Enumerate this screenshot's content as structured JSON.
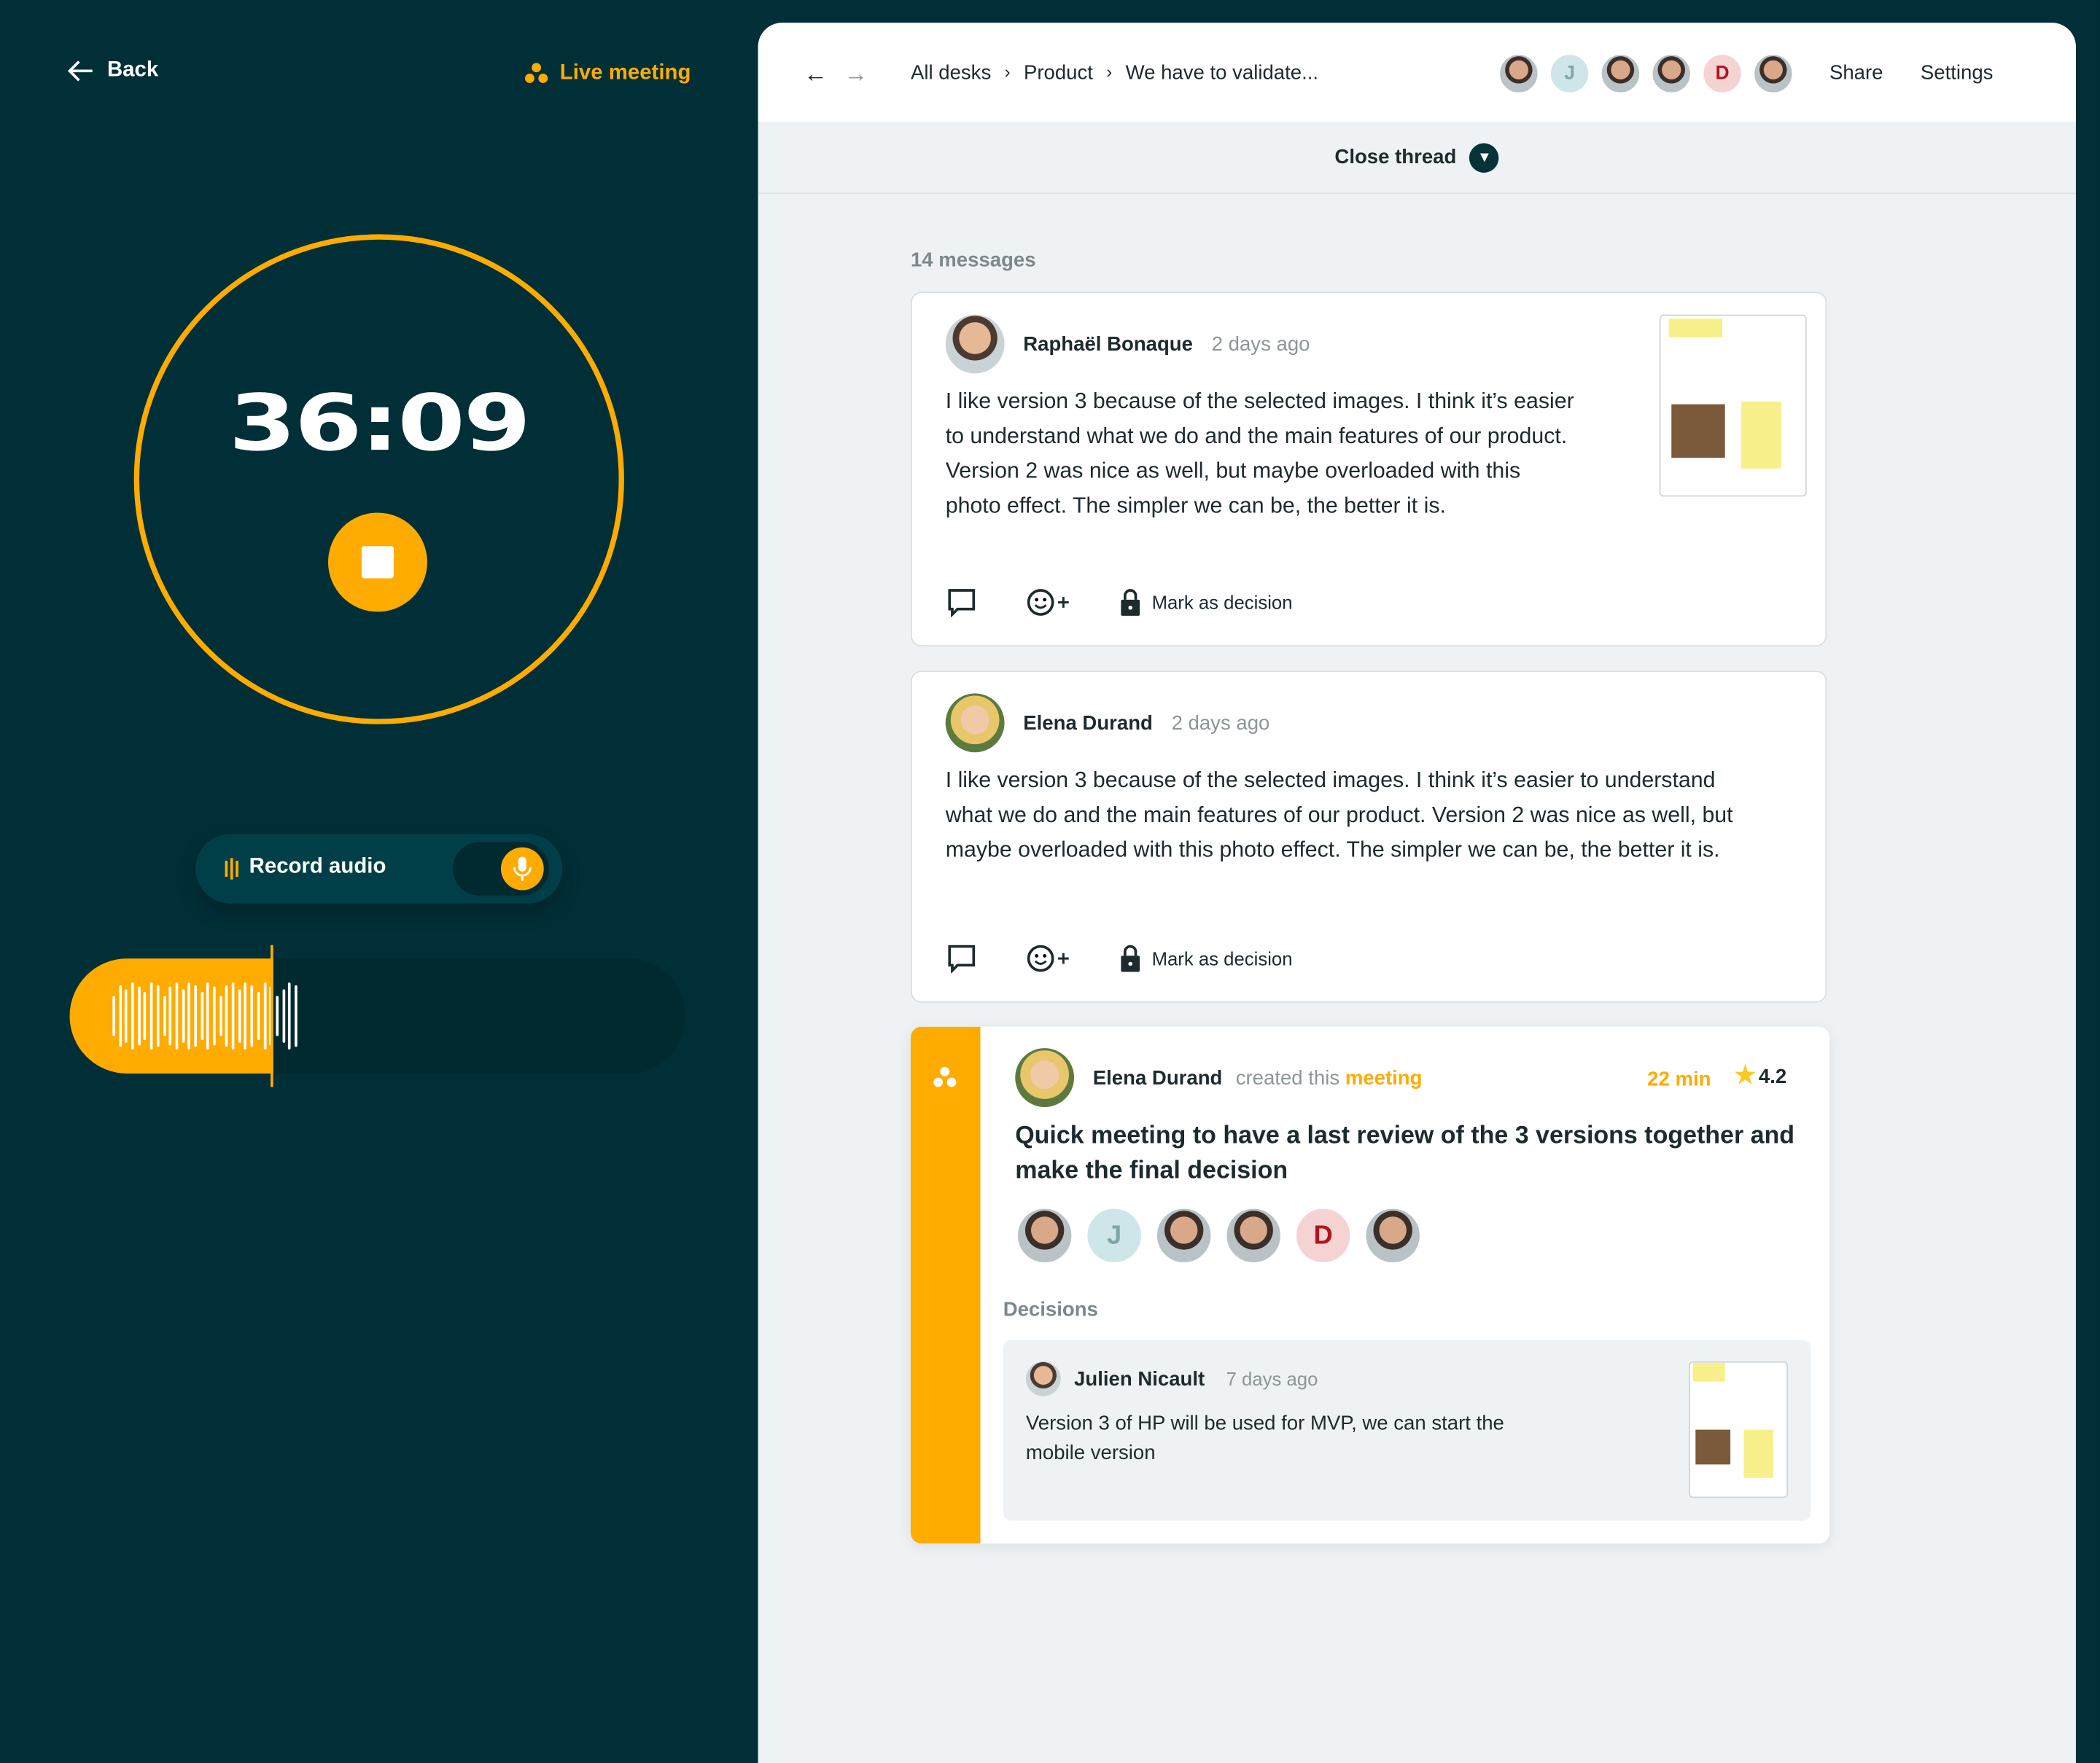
{
  "left": {
    "back_label": "Back",
    "live_label": "Live meeting",
    "timer": "36:09",
    "record_label": "Record audio",
    "record_on": true,
    "recording_progress_percent": 33
  },
  "colors": {
    "accent": "#ffab00",
    "dark": "#002f37"
  },
  "header": {
    "breadcrumbs": [
      "All desks",
      "Product",
      "We have to validate..."
    ],
    "share": "Share",
    "settings": "Settings",
    "participants": [
      "photo",
      "J",
      "photo",
      "photo",
      "D",
      "photo"
    ]
  },
  "thread": {
    "close_label": "Close thread",
    "count": "14 messages"
  },
  "messages": [
    {
      "author": "Raphaël Bonaque",
      "time": "2 days ago",
      "text": "I like version 3 because of the selected images. I think it’s easier to understand what we do and the main features of our product. Version 2 was nice as well, but maybe overloaded with this photo effect.  The simpler we can be, the better it is.",
      "action": "Mark as decision",
      "has_attachment": true
    },
    {
      "author": "Elena Durand",
      "time": "2 days ago",
      "text": "I like version 3 because of the selected images. I think it’s easier to understand what we do and the main features of our product. Version 2 was nice as well, but maybe overloaded with this photo effect.  The simpler we can be, the better it is.",
      "action": "Mark as decision"
    }
  ],
  "meeting": {
    "author": "Elena Durand",
    "created": "created this",
    "keyword": "meeting",
    "duration": "22 min",
    "rating": "4.2",
    "title": "Quick meeting to have a last review of the 3 versions together and make the final decision",
    "participants": [
      "photo",
      "J",
      "photo",
      "photo",
      "D",
      "photo"
    ],
    "decisions_label": "Decisions",
    "decision": {
      "author": "Julien Nicault",
      "time": "7 days ago",
      "text": "Version 3 of HP will be used for MVP, we can start the mobile version"
    }
  }
}
